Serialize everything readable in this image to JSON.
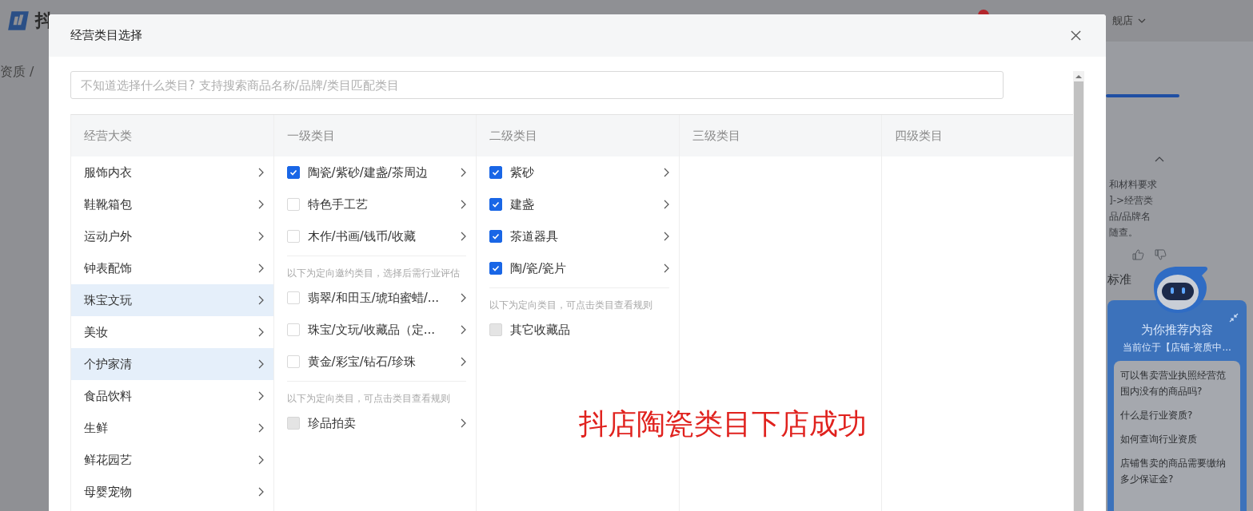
{
  "page": {
    "logo_text": "抖",
    "breadcrumb": "资质 /",
    "shop_name": "舰店",
    "help_lines": [
      "和材料要求",
      "]->经营类",
      "品/品牌名",
      "随查。"
    ],
    "section_title": "标准"
  },
  "assistant": {
    "title": "为你推荐内容",
    "location": "当前位于【店铺-资质中...",
    "questions": [
      "可以售卖营业执照经营范围内没有的商品吗?",
      "什么是行业资质?",
      "如何查询行业资质",
      "店铺售卖的商品需要缴纳多少保证金?"
    ]
  },
  "dialog": {
    "title": "经营类目选择",
    "search": {
      "placeholder": "不知道选择什么类目? 支持搜索商品名称/品牌/类目匹配类目"
    },
    "columns": [
      {
        "title": "经营大类",
        "items": [
          {
            "kind": "plain",
            "label": "服饰内衣",
            "selected": false
          },
          {
            "kind": "plain",
            "label": "鞋靴箱包",
            "selected": false
          },
          {
            "kind": "plain",
            "label": "运动户外",
            "selected": false
          },
          {
            "kind": "plain",
            "label": "钟表配饰",
            "selected": false
          },
          {
            "kind": "plain",
            "label": "珠宝文玩",
            "selected": true
          },
          {
            "kind": "plain",
            "label": "美妆",
            "selected": false
          },
          {
            "kind": "plain",
            "label": "个护家清",
            "selected": true
          },
          {
            "kind": "plain",
            "label": "食品饮料",
            "selected": false
          },
          {
            "kind": "plain",
            "label": "生鲜",
            "selected": false
          },
          {
            "kind": "plain",
            "label": "鲜花园艺",
            "selected": false
          },
          {
            "kind": "plain",
            "label": "母婴宠物",
            "selected": false
          }
        ]
      },
      {
        "title": "一级类目",
        "items": [
          {
            "kind": "check",
            "label": "陶瓷/紫砂/建盏/茶周边",
            "checked": true,
            "disabled": false,
            "arrow": true
          },
          {
            "kind": "check",
            "label": "特色手工艺",
            "checked": false,
            "disabled": false,
            "arrow": true
          },
          {
            "kind": "check",
            "label": "木作/书画/钱币/收藏",
            "checked": false,
            "disabled": false,
            "arrow": true
          },
          {
            "kind": "note",
            "label": "以下为定向邀约类目，选择后需行业评估"
          },
          {
            "kind": "check",
            "label": "翡翠/和田玉/琥珀蜜蜡/...",
            "checked": false,
            "disabled": false,
            "arrow": true
          },
          {
            "kind": "check",
            "label": "珠宝/文玩/收藏品（定...",
            "checked": false,
            "disabled": false,
            "arrow": true
          },
          {
            "kind": "check",
            "label": "黄金/彩宝/钻石/珍珠",
            "checked": false,
            "disabled": false,
            "arrow": true
          },
          {
            "kind": "note",
            "label": "以下为定向类目，可点击类目查看规则"
          },
          {
            "kind": "check",
            "label": "珍品拍卖",
            "checked": false,
            "disabled": true,
            "arrow": true
          }
        ]
      },
      {
        "title": "二级类目",
        "items": [
          {
            "kind": "check",
            "label": "紫砂",
            "checked": true,
            "disabled": false,
            "arrow": true
          },
          {
            "kind": "check",
            "label": "建盏",
            "checked": true,
            "disabled": false,
            "arrow": true
          },
          {
            "kind": "check",
            "label": "茶道器具",
            "checked": true,
            "disabled": false,
            "arrow": true
          },
          {
            "kind": "check",
            "label": "陶/瓷/瓷片",
            "checked": true,
            "disabled": false,
            "arrow": true
          },
          {
            "kind": "note",
            "label": "以下为定向类目，可点击类目查看规则"
          },
          {
            "kind": "check",
            "label": "其它收藏品",
            "checked": false,
            "disabled": true,
            "arrow": false
          }
        ]
      },
      {
        "title": "三级类目"
      },
      {
        "title": "四级类目"
      }
    ],
    "annotation": "抖店陶瓷类目下店成功"
  }
}
